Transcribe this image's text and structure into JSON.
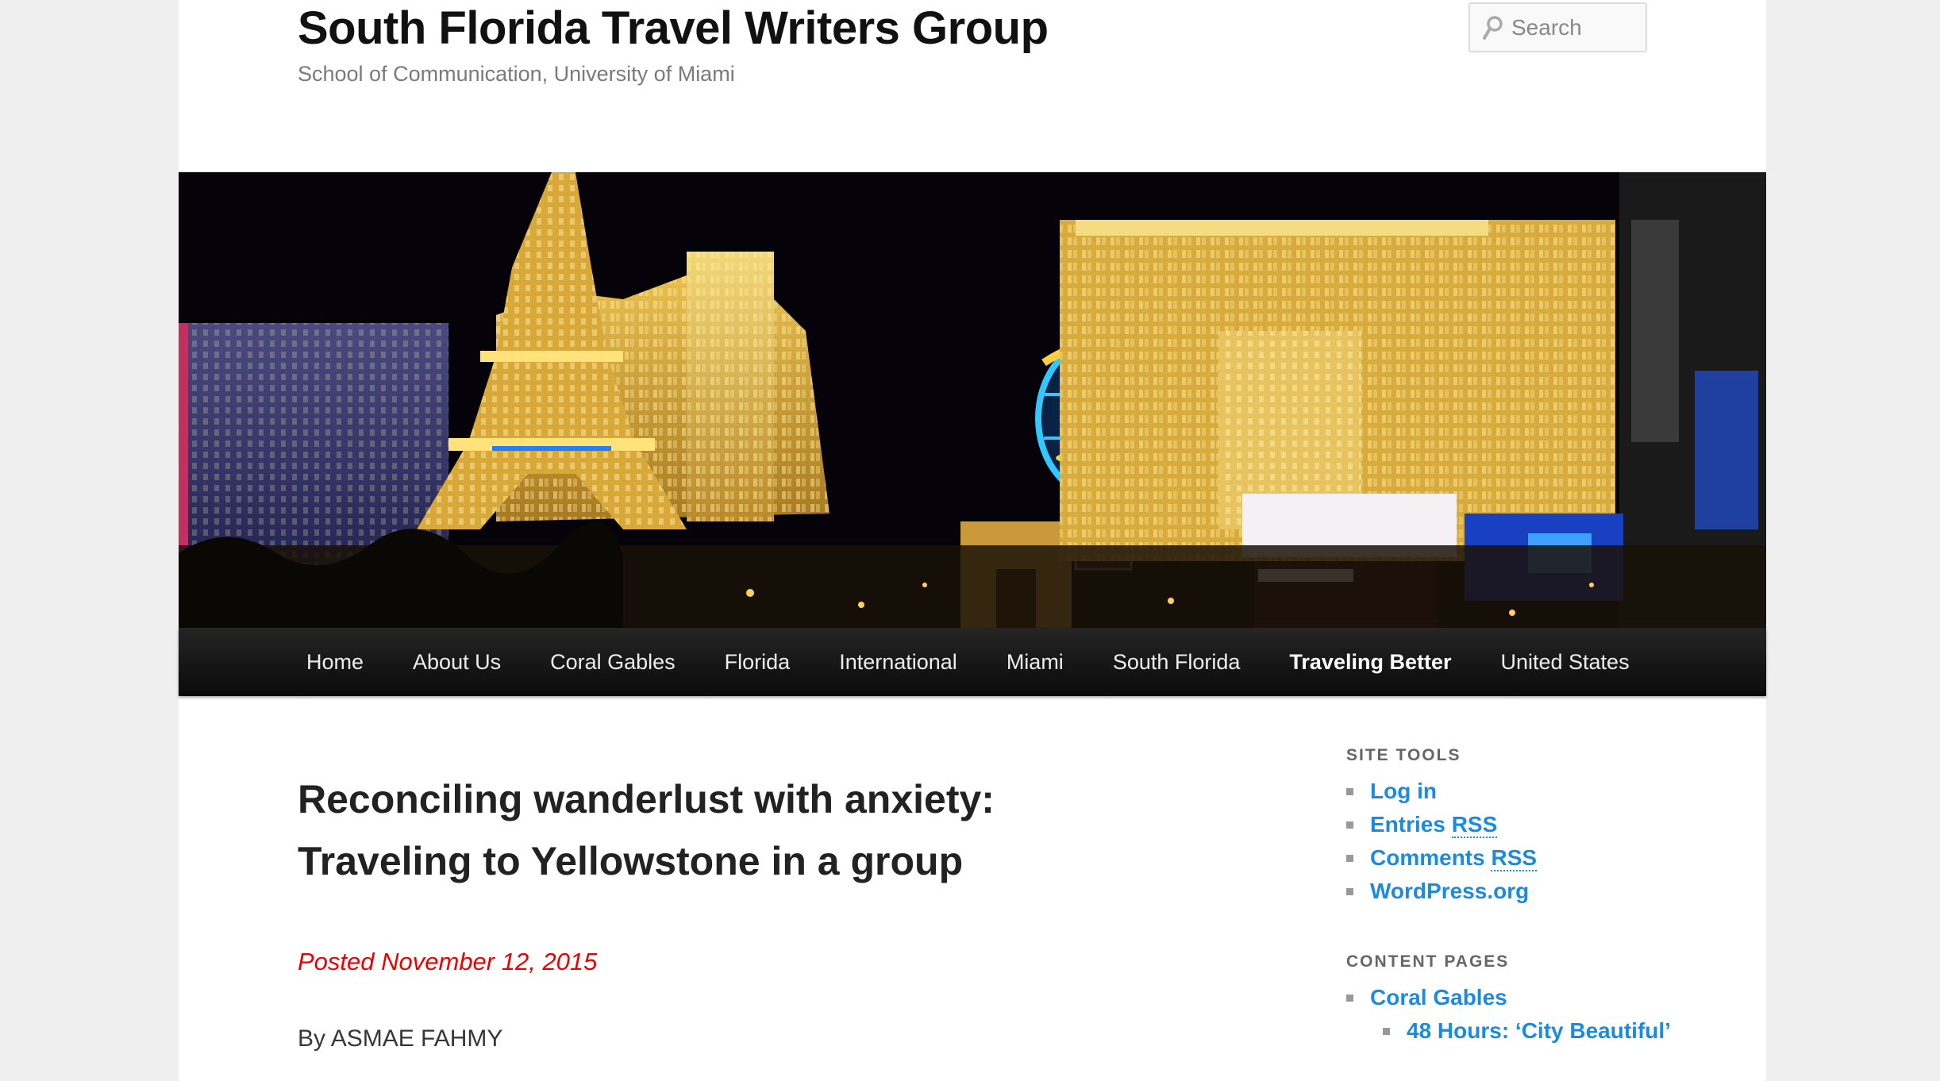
{
  "header": {
    "site_title": "South Florida Travel Writers Group",
    "site_description": "School of Communication, University of Miami",
    "search_placeholder": "Search"
  },
  "banner": {
    "icon": "las-vegas-strip-night-photo"
  },
  "nav": {
    "items": [
      {
        "label": "Home"
      },
      {
        "label": "About Us"
      },
      {
        "label": "Coral Gables"
      },
      {
        "label": "Florida"
      },
      {
        "label": "International"
      },
      {
        "label": "Miami"
      },
      {
        "label": "South Florida"
      },
      {
        "label": "Traveling Better",
        "current": true
      },
      {
        "label": "United States"
      }
    ]
  },
  "post": {
    "title_line1": "Reconciling wanderlust with anxiety:",
    "title_line2": "Traveling to Yellowstone in a group",
    "posted_on": "Posted November 12, 2015",
    "byline": "By ASMAE FAHMY"
  },
  "sidebar": {
    "site_tools": {
      "title": "SITE TOOLS",
      "items": [
        {
          "label": "Log in"
        },
        {
          "label": "Entries ",
          "abbr": "RSS"
        },
        {
          "label": "Comments ",
          "abbr": "RSS"
        },
        {
          "label": "WordPress.org"
        }
      ]
    },
    "content_pages": {
      "title": "CONTENT PAGES",
      "items": [
        {
          "label": "Coral Gables"
        }
      ],
      "sub_items": [
        {
          "label": "48 Hours: ‘City Beautiful’"
        }
      ]
    }
  },
  "colors": {
    "link": "#1b8be0",
    "posted_on": "#ee0000",
    "nav_bg": "#1a1a1a",
    "page_bg": "#efefef"
  }
}
